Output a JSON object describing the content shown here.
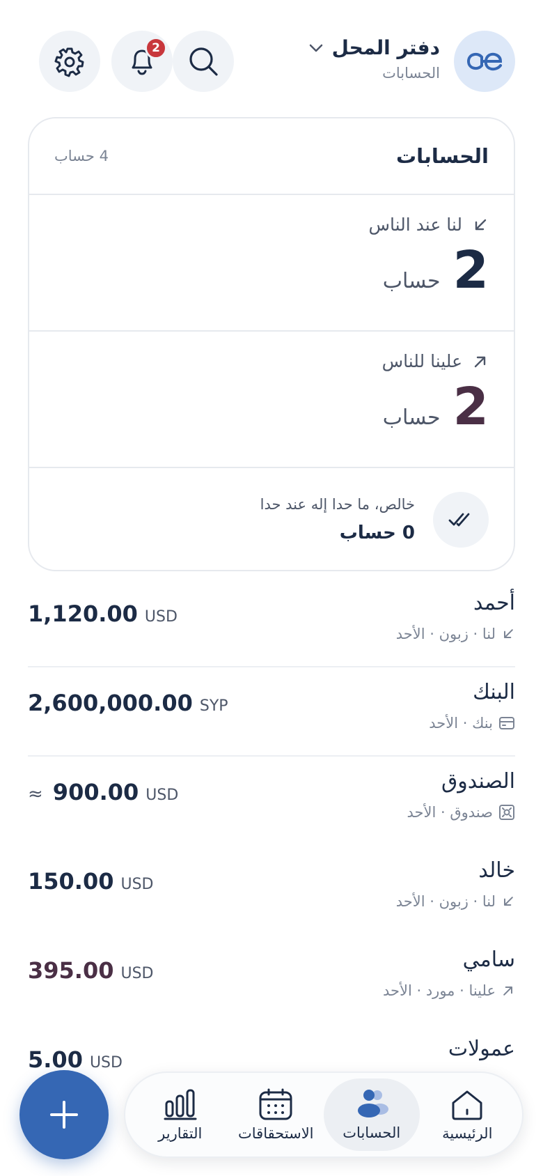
{
  "header": {
    "title": "دفتر المحل",
    "subtitle": "الحسابات",
    "notification_count": "2"
  },
  "summary": {
    "title": "الحسابات",
    "count": "4 حساب",
    "receivable": {
      "label": "لنا عند الناس",
      "value": "2",
      "unit": "حساب"
    },
    "payable": {
      "label": "علينا للناس",
      "value": "2",
      "unit": "حساب"
    },
    "settled": {
      "label": "خالص، ما حدا إله عند حدا",
      "count": "0 حساب"
    }
  },
  "accounts": [
    {
      "name": "أحمد",
      "meta": "لنا · زبون · الأحد",
      "icon": "arrow-down-left-icon",
      "amount": "1,120.00",
      "currency": "USD",
      "approx": "",
      "tone": "normal"
    },
    {
      "name": "البنك",
      "meta": "بنك · الأحد",
      "icon": "card-icon",
      "amount": "2,600,000.00",
      "currency": "SYP",
      "approx": "",
      "tone": "normal"
    },
    {
      "name": "الصندوق",
      "meta": "صندوق · الأحد",
      "icon": "cash-box-icon",
      "amount": "900.00",
      "currency": "USD",
      "approx": "≈",
      "tone": "normal"
    },
    {
      "name": "خالد",
      "meta": "لنا · زبون · الأحد",
      "icon": "arrow-down-left-icon",
      "amount": "150.00",
      "currency": "USD",
      "approx": "",
      "tone": "normal"
    },
    {
      "name": "سامي",
      "meta": "علينا · مورد · الأحد",
      "icon": "arrow-up-right-icon",
      "amount": "395.00",
      "currency": "USD",
      "approx": "",
      "tone": "owe"
    },
    {
      "name": "عمولات",
      "meta": "",
      "icon": "arrow-up-right-icon",
      "amount": "5.00",
      "currency": "USD",
      "approx": "",
      "tone": "normal"
    }
  ],
  "nav": {
    "home": "الرئيسية",
    "accounts": "الحسابات",
    "dues": "الاستحقاقات",
    "reports": "التقارير",
    "active": "accounts"
  },
  "colors": {
    "primary": "#3567b4",
    "text": "#1c2b45",
    "owe": "#4a2f45",
    "badge": "#c8373c"
  }
}
